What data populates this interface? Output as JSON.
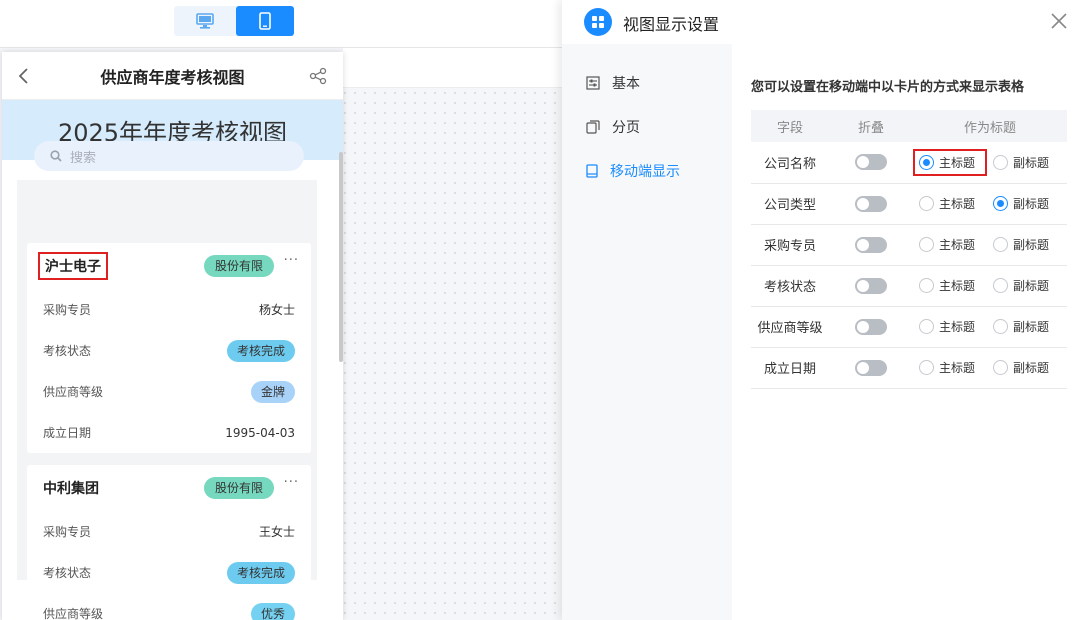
{
  "toolbar": {
    "device_buttons": [
      {
        "icon": "desktop-icon",
        "active": false
      },
      {
        "icon": "mobile-icon",
        "active": true
      }
    ]
  },
  "preview": {
    "header_title": "供应商年度考核视图",
    "banner_title": "2025年年度考核视图",
    "search_placeholder": "搜索",
    "cards": [
      {
        "name": "沪士电子",
        "tag": "股份有限",
        "more": "···",
        "rows": [
          {
            "label": "采购专员",
            "value": "杨女士",
            "style": "text"
          },
          {
            "label": "考核状态",
            "value": "考核完成",
            "style": "pill-blue"
          },
          {
            "label": "供应商等级",
            "value": "金牌",
            "style": "pill-gold"
          },
          {
            "label": "成立日期",
            "value": "1995-04-03",
            "style": "text"
          }
        ]
      },
      {
        "name": "中利集团",
        "tag": "股份有限",
        "more": "···",
        "rows": [
          {
            "label": "采购专员",
            "value": "王女士",
            "style": "text"
          },
          {
            "label": "考核状态",
            "value": "考核完成",
            "style": "pill-blue"
          },
          {
            "label": "供应商等级",
            "value": "优秀",
            "style": "pill-cyan"
          }
        ]
      }
    ]
  },
  "panel": {
    "title": "视图显示设置",
    "nav": [
      {
        "label": "基本",
        "icon": "sliders-icon",
        "active": false
      },
      {
        "label": "分页",
        "icon": "pages-icon",
        "active": false
      },
      {
        "label": "移动端显示",
        "icon": "mobile-icon",
        "active": true
      }
    ],
    "description": "您可以设置在移动端中以卡片的方式来显示表格",
    "table_headers": {
      "field": "字段",
      "fold": "折叠",
      "title_as": "作为标题"
    },
    "main_label": "主标题",
    "sub_label": "副标题",
    "fields": [
      {
        "name": "公司名称",
        "fold": false,
        "title": "main"
      },
      {
        "name": "公司类型",
        "fold": false,
        "title": "sub"
      },
      {
        "name": "采购专员",
        "fold": false,
        "title": "none"
      },
      {
        "name": "考核状态",
        "fold": false,
        "title": "none"
      },
      {
        "name": "供应商等级",
        "fold": false,
        "title": "none"
      },
      {
        "name": "成立日期",
        "fold": false,
        "title": "none"
      }
    ]
  }
}
